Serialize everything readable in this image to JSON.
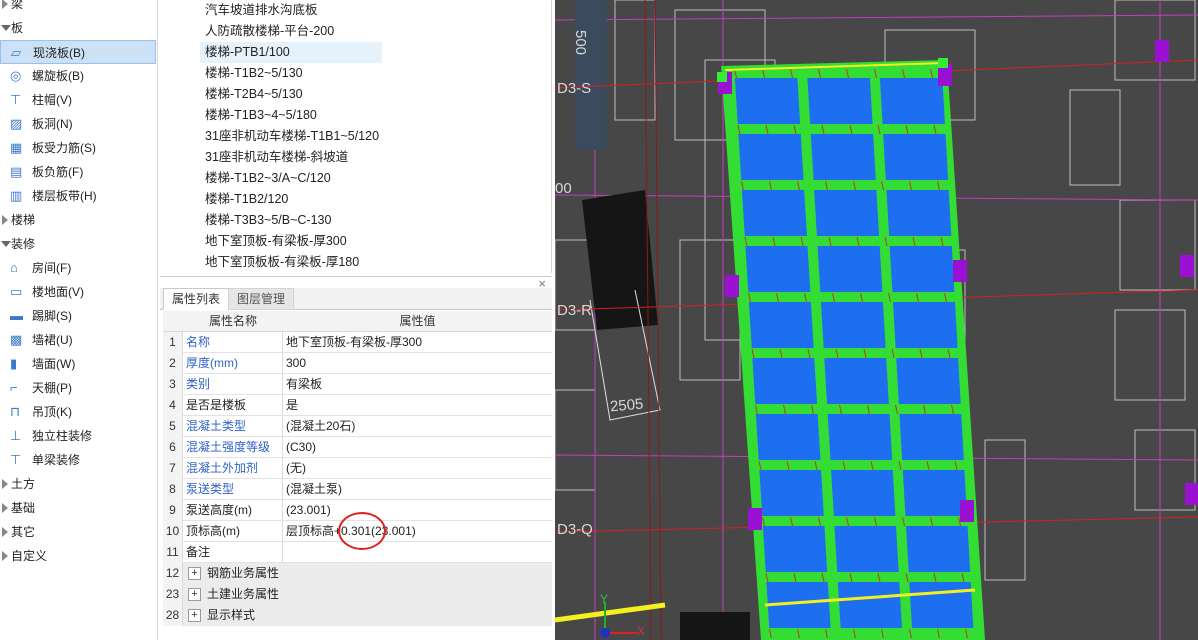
{
  "nav": {
    "rows": [
      {
        "type": "group",
        "label": "梁",
        "icon": "expand-triangle-icon"
      },
      {
        "type": "group",
        "label": "板",
        "icon": "collapse-triangle-icon"
      },
      {
        "type": "child",
        "label": "现浇板(B)",
        "icon": "cast-slab-icon",
        "selected": true
      },
      {
        "type": "child",
        "label": "螺旋板(B)",
        "icon": "spiral-slab-icon"
      },
      {
        "type": "child",
        "label": "柱帽(V)",
        "icon": "column-cap-icon"
      },
      {
        "type": "child",
        "label": "板洞(N)",
        "icon": "slab-opening-icon"
      },
      {
        "type": "child",
        "label": "板受力筋(S)",
        "icon": "slab-main-rebar-icon"
      },
      {
        "type": "child",
        "label": "板负筋(F)",
        "icon": "slab-negative-rebar-icon"
      },
      {
        "type": "child",
        "label": "楼层板带(H)",
        "icon": "floor-slab-strip-icon"
      },
      {
        "type": "group",
        "label": "楼梯",
        "icon": "expand-triangle-icon"
      },
      {
        "type": "group",
        "label": "装修",
        "icon": "collapse-triangle-icon"
      },
      {
        "type": "child",
        "label": "房间(F)",
        "icon": "room-icon"
      },
      {
        "type": "child",
        "label": "楼地面(V)",
        "icon": "floor-finish-icon"
      },
      {
        "type": "child",
        "label": "踢脚(S)",
        "icon": "skirting-icon"
      },
      {
        "type": "child",
        "label": "墙裙(U)",
        "icon": "wainscot-icon"
      },
      {
        "type": "child",
        "label": "墙面(W)",
        "icon": "wall-finish-icon"
      },
      {
        "type": "child",
        "label": "天棚(P)",
        "icon": "ceiling-icon"
      },
      {
        "type": "child",
        "label": "吊顶(K)",
        "icon": "suspended-ceiling-icon"
      },
      {
        "type": "child",
        "label": "独立柱装修",
        "icon": "column-decoration-icon"
      },
      {
        "type": "child",
        "label": "单梁装修",
        "icon": "beam-decoration-icon"
      },
      {
        "type": "group",
        "label": "土方",
        "icon": "expand-triangle-icon"
      },
      {
        "type": "group",
        "label": "基础",
        "icon": "expand-triangle-icon"
      },
      {
        "type": "group",
        "label": "其它",
        "icon": "expand-triangle-icon"
      },
      {
        "type": "group",
        "label": "自定义",
        "icon": "expand-triangle-icon"
      }
    ]
  },
  "component_list": {
    "items": [
      {
        "label": "汽车坡道排水沟底板"
      },
      {
        "label": "人防疏散楼梯-平台-200"
      },
      {
        "label": "楼梯-PTB1/100",
        "selected": true
      },
      {
        "label": "楼梯-T1B2~5/130"
      },
      {
        "label": "楼梯-T2B4~5/130"
      },
      {
        "label": "楼梯-T1B3~4~5/180"
      },
      {
        "label": "31座非机动车楼梯-T1B1~5/120"
      },
      {
        "label": "31座非机动车楼梯-斜坡道"
      },
      {
        "label": "楼梯-T1B2~3/A~C/120"
      },
      {
        "label": "楼梯-T1B2/120"
      },
      {
        "label": "楼梯-T3B3~5/B~C-130"
      },
      {
        "label": "地下室顶板-有梁板-厚300"
      },
      {
        "label": "地下室顶板板-有梁板-厚180"
      }
    ]
  },
  "property_panel": {
    "close_glyph": "×",
    "tabs": [
      {
        "label": "属性列表",
        "active": true
      },
      {
        "label": "图层管理",
        "active": false
      }
    ],
    "header": {
      "name": "属性名称",
      "value": "属性值"
    },
    "rows": [
      {
        "num": "1",
        "name": "名称",
        "value": "地下室顶板-有梁板-厚300",
        "blue": true
      },
      {
        "num": "2",
        "name": "厚度(mm)",
        "value": "300",
        "blue": true
      },
      {
        "num": "3",
        "name": "类别",
        "value": "有梁板",
        "blue": true
      },
      {
        "num": "4",
        "name": "是否是楼板",
        "value": "是",
        "blue": false
      },
      {
        "num": "5",
        "name": "混凝土类型",
        "value": "(混凝土20石)",
        "blue": true
      },
      {
        "num": "6",
        "name": "混凝土强度等级",
        "value": "(C30)",
        "blue": true
      },
      {
        "num": "7",
        "name": "混凝土外加剂",
        "value": "(无)",
        "blue": true
      },
      {
        "num": "8",
        "name": "泵送类型",
        "value": "(混凝土泵)",
        "blue": true
      },
      {
        "num": "9",
        "name": "泵送高度(m)",
        "value": "(23.001)",
        "blue": false
      },
      {
        "num": "10",
        "name": "顶标高(m)",
        "value": "层顶标高+0.301(23.001)",
        "blue": false
      },
      {
        "num": "11",
        "name": "备注",
        "value": "",
        "blue": false
      },
      {
        "num": "12",
        "name": "钢筋业务属性",
        "group": true
      },
      {
        "num": "23",
        "name": "土建业务属性",
        "group": true
      },
      {
        "num": "28",
        "name": "显示样式",
        "group": true
      }
    ],
    "expand_glyph": "+"
  },
  "viewport": {
    "axis_labels": [
      "D3-S",
      "D3-R",
      "D3-Q"
    ],
    "dimension_labels": [
      "500",
      "2505",
      "00"
    ],
    "ucs": {
      "x": "X",
      "y": "Y"
    },
    "colors": {
      "background": "#474747",
      "slab": "#1e6ff0",
      "beam": "#33dd33",
      "grid": "#d42020",
      "column": "#9b11d4",
      "highlight": "#f2f020"
    },
    "annotation": "red-circle-around-0.301"
  }
}
